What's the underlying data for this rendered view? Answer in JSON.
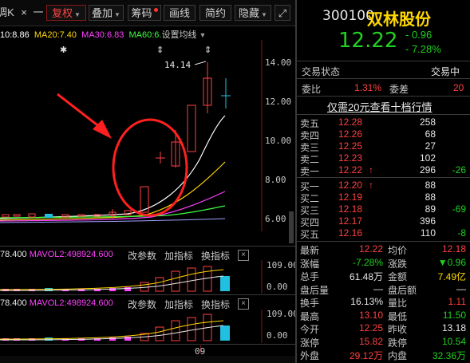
{
  "toolbar": {
    "left_partial": "调K",
    "close_glyph": "×",
    "minus": "一",
    "fuquan": "复权",
    "diejia": "叠加",
    "chouma": "筹码",
    "huaxian": "画线",
    "jianyue": "简约",
    "yincang": "隐藏",
    "expand": "⤢"
  },
  "ma": {
    "ma10": "10:8.86",
    "ma20": "MA20:7.40",
    "ma30": "MA30:6.83",
    "ma60": "MA60:6.",
    "setting": "设置均线"
  },
  "price_axis": [
    "14.00",
    "12.00",
    "10.00",
    "8.00",
    "6.00"
  ],
  "high_label": "14.14",
  "markers": [
    "✱",
    "⬍",
    "⬍"
  ],
  "vol1": {
    "v1": "78.400",
    "v2": "MAVOL2:498924.600",
    "btn1": "改参数",
    "btn2": "加指标",
    "btn3": "换指标",
    "axis_top": "109.00",
    "axis_bottom": "0.00"
  },
  "vol2": {
    "v1": "78.400",
    "v2": "MAVOL2:498924.600",
    "btn1": "改参数",
    "btn2": "加指标",
    "btn3": "换指标",
    "axis_top": "109.00",
    "axis_bottom": "0.00"
  },
  "date_label": "09",
  "quote": {
    "code": "300100",
    "name": "双林股份",
    "price": "12.22",
    "change": "- 0.96",
    "change_pct": "- 7.28%",
    "status_label": "交易状态",
    "status_value": "交易中",
    "weibi_label": "委比",
    "weibi_value": "1.31%",
    "weicha_label": "委差",
    "weicha_value": "20",
    "promo": "仅需20元查看十档行情"
  },
  "asks": [
    {
      "label": "卖五",
      "price": "12.28",
      "vol": "258",
      "chg": ""
    },
    {
      "label": "卖四",
      "price": "12.26",
      "vol": "68",
      "chg": ""
    },
    {
      "label": "卖三",
      "price": "12.25",
      "vol": "27",
      "chg": ""
    },
    {
      "label": "卖二",
      "price": "12.23",
      "vol": "102",
      "chg": ""
    },
    {
      "label": "卖一",
      "price": "12.22",
      "vol": "296",
      "chg": "-26",
      "arrow": "↑"
    }
  ],
  "bids": [
    {
      "label": "买一",
      "price": "12.20",
      "vol": "88",
      "chg": "",
      "arrow": "↑"
    },
    {
      "label": "买二",
      "price": "12.19",
      "vol": "88",
      "chg": ""
    },
    {
      "label": "买三",
      "price": "12.18",
      "vol": "89",
      "chg": "-69"
    },
    {
      "label": "买四",
      "price": "12.17",
      "vol": "396",
      "chg": ""
    },
    {
      "label": "买五",
      "price": "12.16",
      "vol": "110",
      "chg": "-8"
    }
  ],
  "stats": [
    {
      "l1": "最新",
      "v1": "12.22",
      "l2": "均价",
      "v2": "12.18"
    },
    {
      "l1": "涨幅",
      "v1": "-7.28%",
      "l2": "涨跌",
      "v2": "▼0.96"
    },
    {
      "l1": "总手",
      "v1": "61.48万",
      "l2": "金额",
      "v2": "7.49亿"
    },
    {
      "l1": "盘后量",
      "v1": "—",
      "l2": "盘后额",
      "v2": "—"
    },
    {
      "l1": "换手",
      "v1": "16.13%",
      "l2": "量比",
      "v2": "1.11"
    },
    {
      "l1": "最高",
      "v1": "13.10",
      "l2": "最低",
      "v2": "11.50"
    },
    {
      "l1": "今开",
      "v1": "12.25",
      "l2": "昨收",
      "v2": "13.18"
    },
    {
      "l1": "涨停",
      "v1": "15.82",
      "l2": "跌停",
      "v2": "10.54"
    },
    {
      "l1": "外盘",
      "v1": "29.12万",
      "l2": "内盘",
      "v2": "32.36万"
    }
  ],
  "colors": {
    "up": "#ff4040",
    "down": "#20d020",
    "accent": "#ffd700",
    "ma10": "#ffffff",
    "ma20": "#ffd700",
    "ma30": "#ff40ff",
    "ma60": "#40ff40",
    "annotation": "#ff2020"
  }
}
